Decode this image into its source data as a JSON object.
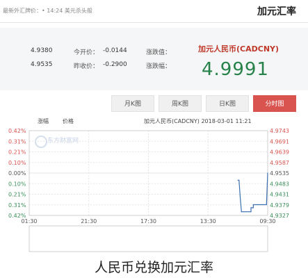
{
  "header": {
    "title": "加元汇率",
    "update_text": "最新外汇牌价：• 14:24 美元杀头般"
  },
  "quote": {
    "name": "加元人民币(CADCNY)",
    "price": "4.9991",
    "rows": [
      {
        "label1": "涨跌值：",
        "value1": "-0.0144",
        "label2": "今开价：",
        "value2": "4.9380"
      },
      {
        "label1": "涨跌幅：",
        "value1": "-0.2900",
        "label2": "昨收价：",
        "value2": "4.9535"
      }
    ]
  },
  "tabs": [
    {
      "label": "分时图",
      "active": true
    },
    {
      "label": "日K图",
      "active": false
    },
    {
      "label": "周K图",
      "active": false
    },
    {
      "label": "月K图",
      "active": false
    }
  ],
  "chart_info": {
    "line1": "加元人民币(CADCNY)  2018-03-01 11:21",
    "line2": "价格",
    "line3": "涨幅",
    "watermark": "东方财富网"
  },
  "caption": "人民币兑换加元汇率",
  "colors": {
    "up": "#d9534f",
    "down": "#3a8f5a",
    "line": "#3a6fb0",
    "grid": "#e5e5e5"
  },
  "chart_data": {
    "type": "line",
    "x_ticks": [
      "09:30",
      "13:30",
      "17:30",
      "21:30",
      "01:30"
    ],
    "y_left_ticks": [
      "0.42%",
      "0.31%",
      "0.21%",
      "0.10%",
      "0.00%",
      "0.10%",
      "0.21%",
      "0.31%",
      "0.42%"
    ],
    "y_right_ticks": [
      "4.9743",
      "4.9691",
      "4.9639",
      "4.9587",
      "4.9535",
      "4.9483",
      "4.9431",
      "4.9379",
      "4.9327"
    ],
    "ylim": [
      4.9327,
      4.9743
    ],
    "base": 4.9535,
    "series": [
      {
        "name": "价格",
        "values": [
          4.9535,
          4.9535,
          4.938,
          4.938,
          4.938,
          4.938,
          4.9365,
          4.9365,
          4.9345,
          4.9345,
          4.9345,
          4.9345,
          4.9345,
          4.941,
          4.95,
          4.95
        ]
      }
    ],
    "series_x": [
      0.0,
      0.0,
      0.005,
      0.02,
      0.04,
      0.06,
      0.06,
      0.07,
      0.07,
      0.08,
      0.09,
      0.1,
      0.11,
      0.115,
      0.12,
      0.125
    ]
  }
}
